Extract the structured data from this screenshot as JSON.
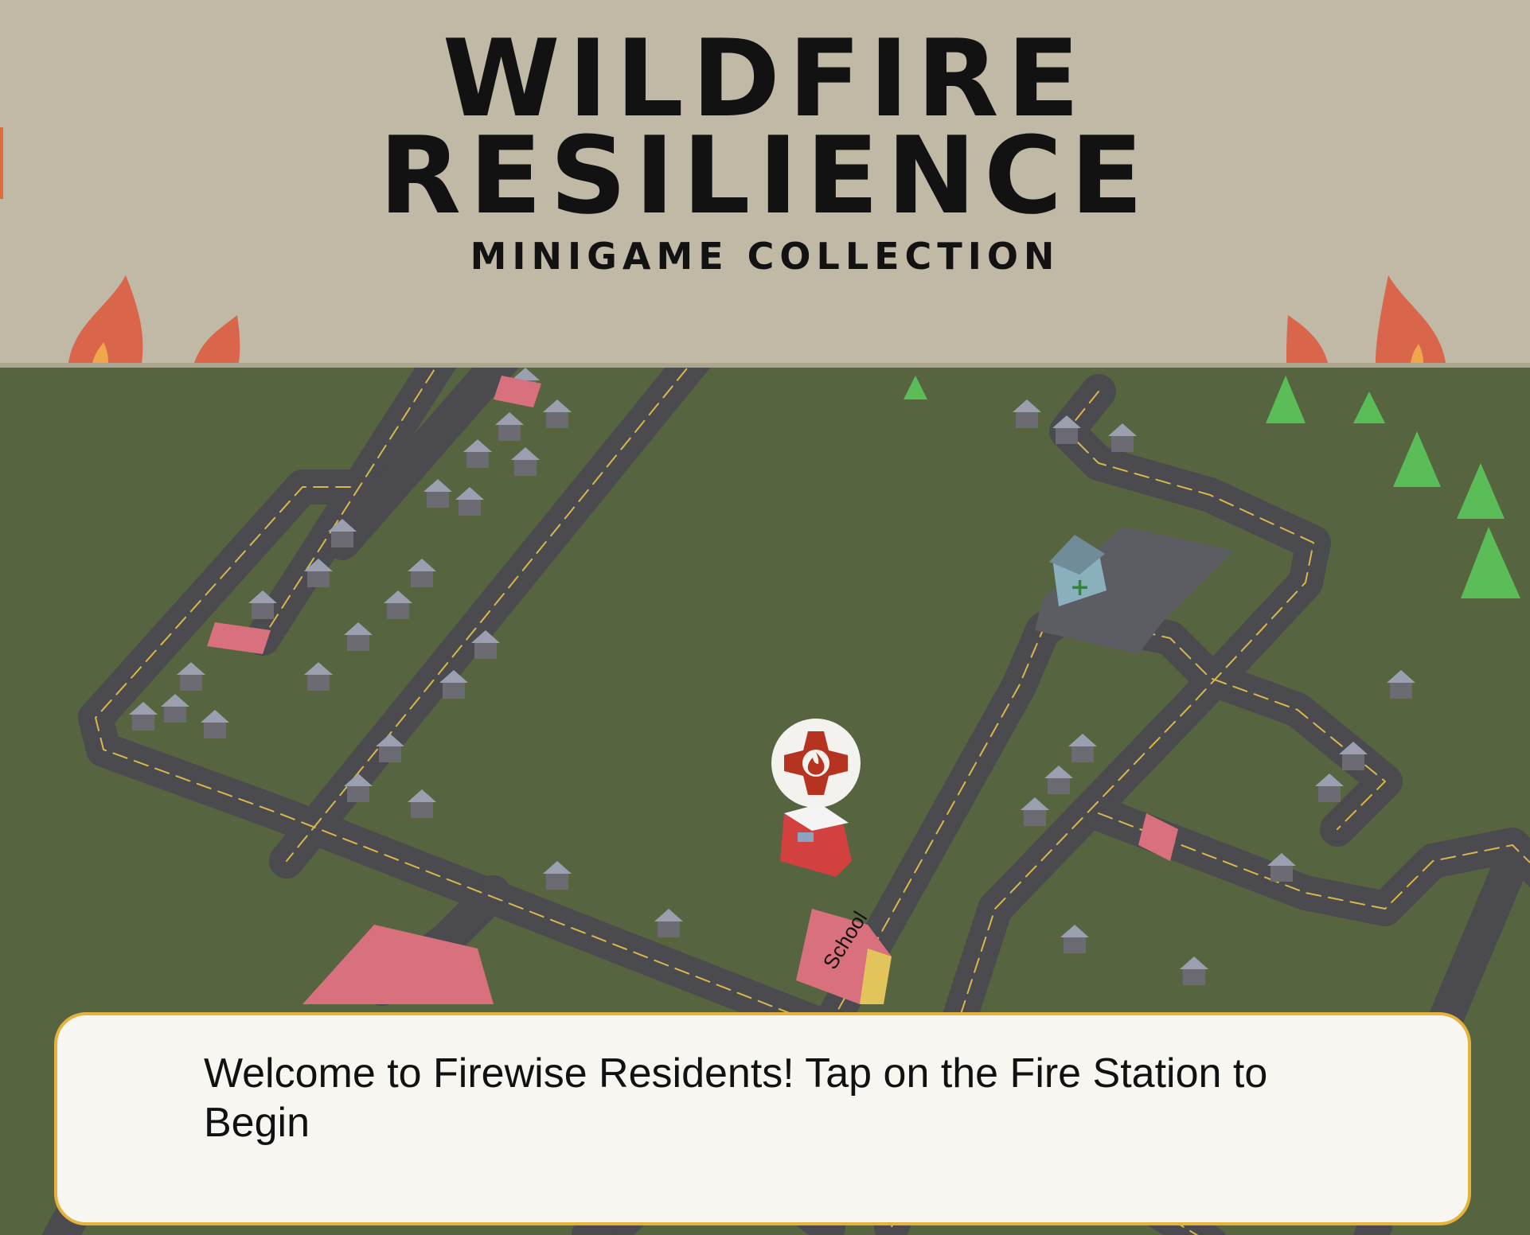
{
  "header": {
    "title_line1": "WILDFIRE",
    "title_line2": "RESILIENCE",
    "subtitle": "MINIGAME COLLECTION"
  },
  "map": {
    "school_label": "School",
    "fire_station_icon": "fire-department-maltese-cross-icon",
    "hospital_icon": "hospital-cross-icon"
  },
  "dialog": {
    "message": "Welcome to Firewise Residents! Tap on the Fire Station to Begin"
  },
  "colors": {
    "header_bg": "#c0b9a6",
    "grass": "#566440",
    "road": "#4b4b4f",
    "road_line": "#d8b84a",
    "flame": "#d9654a",
    "fire_badge": "#b5331f",
    "dialog_border": "#e6b23c",
    "dialog_bg": "#f7f6f1"
  }
}
